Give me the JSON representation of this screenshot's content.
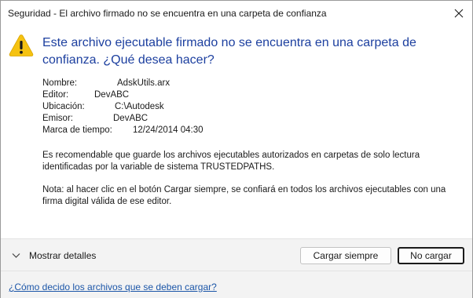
{
  "window": {
    "title": "Seguridad - El archivo firmado no se encuentra en una carpeta de confianza"
  },
  "dialog": {
    "heading": "Este archivo ejecutable firmado no se encuentra en una carpeta de confianza. ¿Qué desea hacer?",
    "fields": [
      {
        "label": "Nombre:",
        "value": "AdskUtils.arx"
      },
      {
        "label": "Editor:",
        "value": "DevABC"
      },
      {
        "label": "Ubicación:",
        "value": "C:\\Autodesk"
      },
      {
        "label": "Emisor:",
        "value": "DevABC"
      },
      {
        "label": "Marca de tiempo:",
        "value": "12/24/2014 04:30"
      }
    ],
    "recommendation": "Es recomendable que guarde los archivos ejecutables autorizados en carpetas de solo lectura identificadas por la variable de sistema TRUSTEDPATHS.",
    "note": "Nota: al hacer clic en el botón Cargar siempre, se confiará en todos los archivos ejecutables con una firma digital válida de ese editor."
  },
  "footer": {
    "details_label": "Mostrar detalles",
    "load_always_label": "Cargar siempre",
    "no_load_label": "No cargar",
    "help_link": "¿Cómo decido los archivos que se deben cargar?"
  },
  "colors": {
    "heading": "#1c3f9f",
    "link": "#1c56a8",
    "warning": "#f5c211"
  },
  "icons": {
    "close": "close-icon",
    "warning": "warning-icon",
    "expand": "chevron-down-icon"
  }
}
